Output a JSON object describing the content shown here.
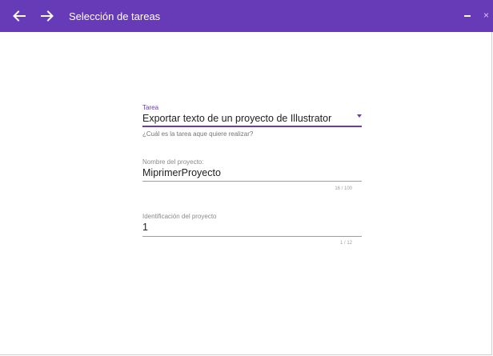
{
  "window": {
    "title": "Selección de tareas",
    "close_glyph": "×",
    "back_icon": "arrow-left-icon",
    "forward_icon": "arrow-right-icon",
    "minimize_icon": "minimize-icon",
    "close_icon": "close-icon"
  },
  "colors": {
    "accent": "#673ab7",
    "titlebar_bg": "#673ab7",
    "text": "#212121",
    "label": "#8a8a8a",
    "underline": "#9e9e9e"
  },
  "form": {
    "task": {
      "label": "Tarea",
      "value": "Exportar texto de un proyecto de Illustrator",
      "helper": "¿Cuál es la tarea aque quiere realizar?",
      "caret_icon": "dropdown-caret-icon"
    },
    "project_name": {
      "label": "Nombre del proyecto:",
      "value": "MiprimerProyecto",
      "counter": "16 / 100"
    },
    "project_id": {
      "label": "Identificación del proyecto",
      "value": "1",
      "counter": "1 / 12"
    }
  }
}
